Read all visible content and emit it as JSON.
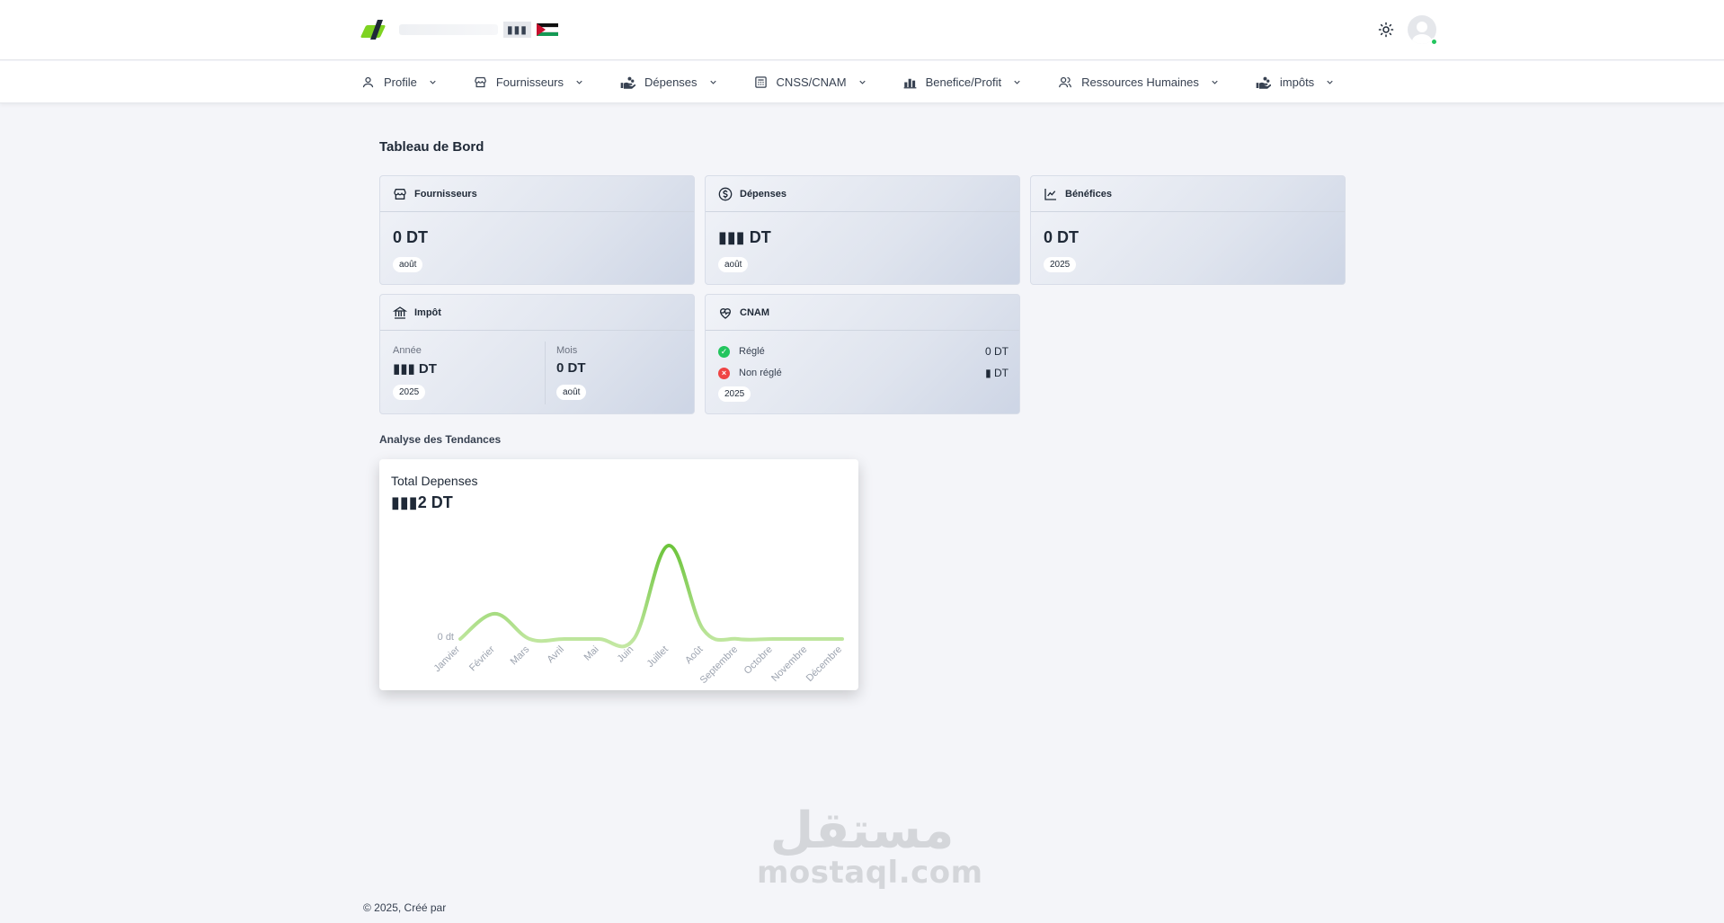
{
  "header": {
    "logo_text": "▮▮▮",
    "theme_toggle_icon": "sun-icon"
  },
  "nav": {
    "items": [
      {
        "label": "Profile",
        "icon": "user-icon"
      },
      {
        "label": "Fournisseurs",
        "icon": "store-icon"
      },
      {
        "label": "Dépenses",
        "icon": "hand-coins-icon"
      },
      {
        "label": "CNSS/CNAM",
        "icon": "calculator-icon"
      },
      {
        "label": "Benefice/Profit",
        "icon": "bar-chart-icon"
      },
      {
        "label": "Ressources Humaines",
        "icon": "users-icon"
      },
      {
        "label": "impôts",
        "icon": "hand-coins-icon"
      }
    ]
  },
  "dashboard": {
    "title": "Tableau de Bord",
    "fournisseurs": {
      "title": "Fournisseurs",
      "value": "0 DT",
      "period": "août"
    },
    "depenses": {
      "title": "Dépenses",
      "value": "▮▮▮ DT",
      "period": "août"
    },
    "benefices": {
      "title": "Bénéfices",
      "value": "0 DT",
      "period": "2025"
    },
    "impot": {
      "title": "Impôt",
      "annee_label": "Année",
      "annee_value": "▮▮▮ DT",
      "annee_period": "2025",
      "mois_label": "Mois",
      "mois_value": "0 DT",
      "mois_period": "août"
    },
    "cnam": {
      "title": "CNAM",
      "regle_label": "Réglé",
      "regle_value": "0 DT",
      "non_regle_label": "Non réglé",
      "non_regle_value": "▮ DT",
      "period": "2025"
    }
  },
  "trends": {
    "section_title": "Analyse des Tendances",
    "chart_title": "Total Depenses",
    "chart_total": "▮▮▮2 DT"
  },
  "chart_data": {
    "type": "area",
    "title": "Total Depenses",
    "categories": [
      "Janvier",
      "Février",
      "Mars",
      "Avril",
      "Mai",
      "Juin",
      "Juillet",
      "Août",
      "Septembre",
      "Octobre",
      "Novembre",
      "Décembre"
    ],
    "values": [
      0,
      0.27,
      0,
      0,
      0,
      0,
      1,
      0.1,
      0,
      0,
      0,
      0
    ],
    "ytick_label": "0 dt",
    "colors": {
      "peak": "#6cc43b",
      "base": "#c4e8a4"
    }
  },
  "footer": {
    "text": "© 2025, Créé par"
  },
  "watermark": {
    "arabic": "مستقل",
    "latin": "mostaql.com"
  },
  "colors": {
    "accent": "#7ed321",
    "online": "#22c55e",
    "success": "#22c55e",
    "danger": "#ef4444"
  }
}
